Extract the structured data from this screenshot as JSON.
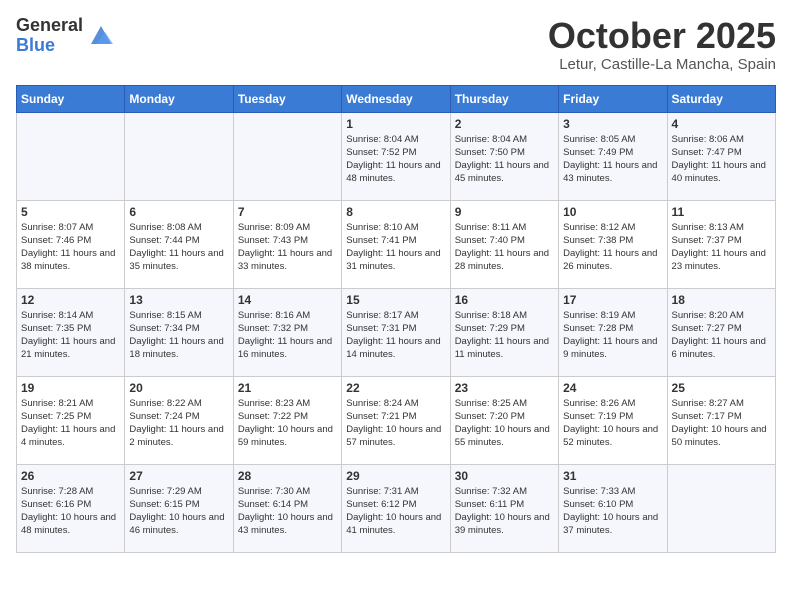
{
  "logo": {
    "general": "General",
    "blue": "Blue"
  },
  "title": "October 2025",
  "location": "Letur, Castille-La Mancha, Spain",
  "headers": [
    "Sunday",
    "Monday",
    "Tuesday",
    "Wednesday",
    "Thursday",
    "Friday",
    "Saturday"
  ],
  "weeks": [
    [
      {
        "day": "",
        "info": ""
      },
      {
        "day": "",
        "info": ""
      },
      {
        "day": "",
        "info": ""
      },
      {
        "day": "1",
        "info": "Sunrise: 8:04 AM\nSunset: 7:52 PM\nDaylight: 11 hours and 48 minutes."
      },
      {
        "day": "2",
        "info": "Sunrise: 8:04 AM\nSunset: 7:50 PM\nDaylight: 11 hours and 45 minutes."
      },
      {
        "day": "3",
        "info": "Sunrise: 8:05 AM\nSunset: 7:49 PM\nDaylight: 11 hours and 43 minutes."
      },
      {
        "day": "4",
        "info": "Sunrise: 8:06 AM\nSunset: 7:47 PM\nDaylight: 11 hours and 40 minutes."
      }
    ],
    [
      {
        "day": "5",
        "info": "Sunrise: 8:07 AM\nSunset: 7:46 PM\nDaylight: 11 hours and 38 minutes."
      },
      {
        "day": "6",
        "info": "Sunrise: 8:08 AM\nSunset: 7:44 PM\nDaylight: 11 hours and 35 minutes."
      },
      {
        "day": "7",
        "info": "Sunrise: 8:09 AM\nSunset: 7:43 PM\nDaylight: 11 hours and 33 minutes."
      },
      {
        "day": "8",
        "info": "Sunrise: 8:10 AM\nSunset: 7:41 PM\nDaylight: 11 hours and 31 minutes."
      },
      {
        "day": "9",
        "info": "Sunrise: 8:11 AM\nSunset: 7:40 PM\nDaylight: 11 hours and 28 minutes."
      },
      {
        "day": "10",
        "info": "Sunrise: 8:12 AM\nSunset: 7:38 PM\nDaylight: 11 hours and 26 minutes."
      },
      {
        "day": "11",
        "info": "Sunrise: 8:13 AM\nSunset: 7:37 PM\nDaylight: 11 hours and 23 minutes."
      }
    ],
    [
      {
        "day": "12",
        "info": "Sunrise: 8:14 AM\nSunset: 7:35 PM\nDaylight: 11 hours and 21 minutes."
      },
      {
        "day": "13",
        "info": "Sunrise: 8:15 AM\nSunset: 7:34 PM\nDaylight: 11 hours and 18 minutes."
      },
      {
        "day": "14",
        "info": "Sunrise: 8:16 AM\nSunset: 7:32 PM\nDaylight: 11 hours and 16 minutes."
      },
      {
        "day": "15",
        "info": "Sunrise: 8:17 AM\nSunset: 7:31 PM\nDaylight: 11 hours and 14 minutes."
      },
      {
        "day": "16",
        "info": "Sunrise: 8:18 AM\nSunset: 7:29 PM\nDaylight: 11 hours and 11 minutes."
      },
      {
        "day": "17",
        "info": "Sunrise: 8:19 AM\nSunset: 7:28 PM\nDaylight: 11 hours and 9 minutes."
      },
      {
        "day": "18",
        "info": "Sunrise: 8:20 AM\nSunset: 7:27 PM\nDaylight: 11 hours and 6 minutes."
      }
    ],
    [
      {
        "day": "19",
        "info": "Sunrise: 8:21 AM\nSunset: 7:25 PM\nDaylight: 11 hours and 4 minutes."
      },
      {
        "day": "20",
        "info": "Sunrise: 8:22 AM\nSunset: 7:24 PM\nDaylight: 11 hours and 2 minutes."
      },
      {
        "day": "21",
        "info": "Sunrise: 8:23 AM\nSunset: 7:22 PM\nDaylight: 10 hours and 59 minutes."
      },
      {
        "day": "22",
        "info": "Sunrise: 8:24 AM\nSunset: 7:21 PM\nDaylight: 10 hours and 57 minutes."
      },
      {
        "day": "23",
        "info": "Sunrise: 8:25 AM\nSunset: 7:20 PM\nDaylight: 10 hours and 55 minutes."
      },
      {
        "day": "24",
        "info": "Sunrise: 8:26 AM\nSunset: 7:19 PM\nDaylight: 10 hours and 52 minutes."
      },
      {
        "day": "25",
        "info": "Sunrise: 8:27 AM\nSunset: 7:17 PM\nDaylight: 10 hours and 50 minutes."
      }
    ],
    [
      {
        "day": "26",
        "info": "Sunrise: 7:28 AM\nSunset: 6:16 PM\nDaylight: 10 hours and 48 minutes."
      },
      {
        "day": "27",
        "info": "Sunrise: 7:29 AM\nSunset: 6:15 PM\nDaylight: 10 hours and 46 minutes."
      },
      {
        "day": "28",
        "info": "Sunrise: 7:30 AM\nSunset: 6:14 PM\nDaylight: 10 hours and 43 minutes."
      },
      {
        "day": "29",
        "info": "Sunrise: 7:31 AM\nSunset: 6:12 PM\nDaylight: 10 hours and 41 minutes."
      },
      {
        "day": "30",
        "info": "Sunrise: 7:32 AM\nSunset: 6:11 PM\nDaylight: 10 hours and 39 minutes."
      },
      {
        "day": "31",
        "info": "Sunrise: 7:33 AM\nSunset: 6:10 PM\nDaylight: 10 hours and 37 minutes."
      },
      {
        "day": "",
        "info": ""
      }
    ]
  ]
}
